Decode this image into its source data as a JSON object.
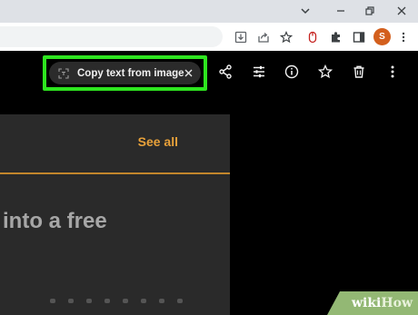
{
  "window": {
    "controls": [
      "chevron-down-icon",
      "minimize-icon",
      "restore-icon",
      "close-icon"
    ]
  },
  "toolbar": {
    "icons": [
      "download-icon",
      "share-icon",
      "star-icon",
      "extension-mouse-icon",
      "puzzle-icon",
      "sidepanel-icon"
    ],
    "avatar_letter": "S",
    "avatar_color": "#d35f1d"
  },
  "viewer": {
    "copy_text_chip": {
      "label": "Copy text from image"
    },
    "highlight_color": "#2ee51f",
    "actions": [
      "share-icon",
      "tune-icon",
      "info-icon",
      "star-icon",
      "trash-icon",
      "more-vert-icon"
    ]
  },
  "image": {
    "see_all": "See all",
    "headline": "into a free",
    "accent_color": "#e8a13a"
  },
  "watermark": {
    "part1": "wiki",
    "part2": "How"
  }
}
